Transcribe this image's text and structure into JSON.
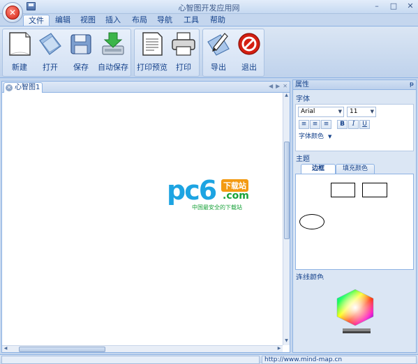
{
  "window": {
    "title": "心智图开发应用网",
    "minimize_glyph": "–",
    "maximize_glyph": "□",
    "close_glyph": "✕"
  },
  "app_orb_glyph": "✕",
  "menu": {
    "tabs": [
      "文件",
      "编辑",
      "视图",
      "插入",
      "布局",
      "导航",
      "工具",
      "帮助"
    ],
    "active_index": 0
  },
  "ribbon": {
    "buttons": [
      {
        "label": "新建",
        "icon": "new-document-icon"
      },
      {
        "label": "打开",
        "icon": "open-folder-icon"
      },
      {
        "label": "保存",
        "icon": "save-disk-icon"
      },
      {
        "label": "自动保存",
        "icon": "auto-save-icon"
      },
      {
        "label": "打印预览",
        "icon": "print-preview-icon"
      },
      {
        "label": "打印",
        "icon": "printer-icon"
      },
      {
        "label": "导出",
        "icon": "export-icon"
      },
      {
        "label": "退出",
        "icon": "exit-icon"
      }
    ]
  },
  "document": {
    "tab_label": "心智图1",
    "nav_left": "◀",
    "nav_right": "▶",
    "nav_close": "✕"
  },
  "watermark": {
    "big": "pc6",
    "badge": "下载站",
    "dotcom": ".com",
    "sub": "中国最安全的下载站"
  },
  "panel": {
    "title": "属性",
    "pin_glyph": "ᵽ",
    "font_section": "字体",
    "font_name": "Arial",
    "font_size": "11",
    "align_left": "≡",
    "align_center": "≡",
    "align_right": "≡",
    "bold": "B",
    "italic": "I",
    "underline": "U",
    "font_color_label": "字体颜色",
    "theme_section": "主题",
    "theme_tabs": [
      "边框",
      "填充颜色"
    ],
    "theme_active_index": 0,
    "line_color_section": "连线颜色"
  },
  "status": {
    "url": "http://www.mind-map.cn"
  },
  "colors": {
    "accent": "#15428b",
    "ribbon_border": "#8db2e3",
    "watermark_blue": "#1da4e2",
    "watermark_green": "#18a23a",
    "watermark_orange": "#f39a12",
    "exit_red": "#d41f12"
  }
}
